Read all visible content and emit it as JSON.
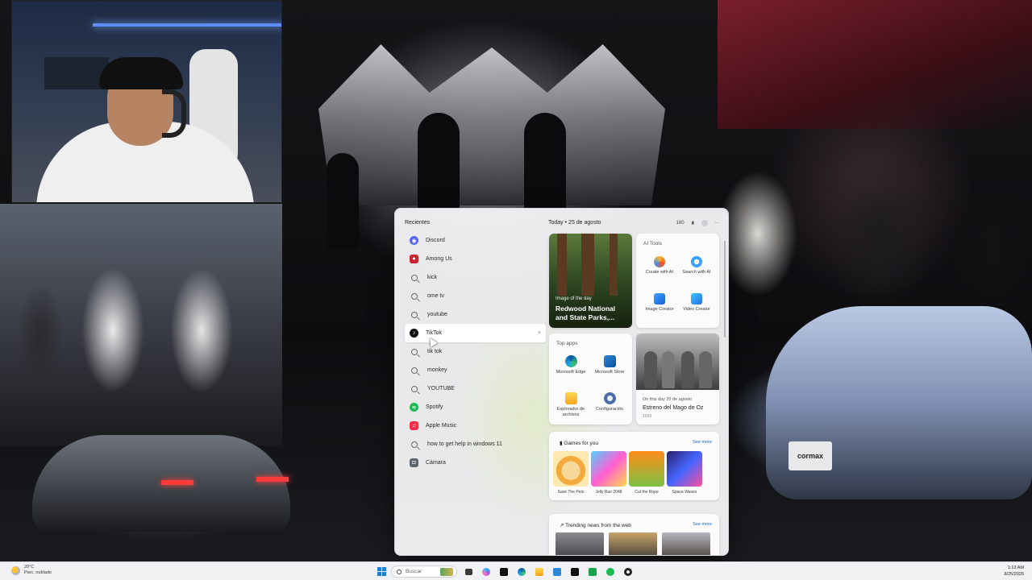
{
  "start_menu": {
    "recent_title": "Recientes",
    "recent": [
      {
        "label": "Discord",
        "icon": "discord-icon",
        "color": "#5865F2",
        "type": "app"
      },
      {
        "label": "Among Us",
        "icon": "among-us-icon",
        "color": "#c7262c",
        "type": "app"
      },
      {
        "label": "kick",
        "icon": "search-icon",
        "type": "search"
      },
      {
        "label": "ome tv",
        "icon": "search-icon",
        "type": "search"
      },
      {
        "label": "youtube",
        "icon": "search-icon",
        "type": "search"
      },
      {
        "label": "TikTok",
        "icon": "tiktok-icon",
        "color": "#111111",
        "type": "app",
        "active": true
      },
      {
        "label": "tik tok",
        "icon": "search-icon",
        "type": "search"
      },
      {
        "label": "monkey",
        "icon": "search-icon",
        "type": "search"
      },
      {
        "label": "YOUTUBE",
        "icon": "search-icon",
        "type": "search"
      },
      {
        "label": "Spotify",
        "icon": "spotify-icon",
        "color": "#1DB954",
        "type": "app"
      },
      {
        "label": "Apple Music",
        "icon": "apple-music-icon",
        "color": "#fa2d48",
        "type": "app"
      },
      {
        "label": "how to get help in windows 11",
        "icon": "search-icon",
        "type": "search"
      },
      {
        "label": "Cámara",
        "icon": "camera-icon",
        "color": "#5b6270",
        "type": "app"
      }
    ],
    "close_glyph": "×"
  },
  "widgets": {
    "today": "Today",
    "sep": "•",
    "date": "25 de agosto",
    "points": "160",
    "more": "···",
    "image_of_day": {
      "label": "Image of the day",
      "title": "Redwood National and State Parks,..."
    },
    "ai_tools": {
      "title": "AI Tools",
      "items": [
        "Create with AI",
        "Search with AI",
        "Image Creator",
        "Video Creator"
      ]
    },
    "top_apps": {
      "title": "Top apps",
      "items": [
        "Microsoft Edge",
        "Microsoft Store",
        "Explorador de archivos",
        "Configuración"
      ]
    },
    "on_this_day": {
      "date": "On this day 25 de agosto",
      "title": "Estreno del Mago de Oz",
      "year": "1939"
    },
    "games": {
      "title": "Games for you",
      "see_more": "See more",
      "items": [
        "Save The Pets",
        "Jelly Run 2048",
        "Cut the Rope",
        "Space Waves"
      ]
    },
    "news": {
      "title": "Trending news from the web",
      "see_more": "See more"
    }
  },
  "taskbar": {
    "weather_temp": "20°C",
    "weather_desc": "Parc. nublado",
    "search_placeholder": "Buscar",
    "time": "1:13 AM",
    "date": "8/25/2026"
  },
  "wallpaper": {
    "plate_text": "cormax"
  },
  "colors": {
    "accent": "#1a64b8",
    "menu_bg": "#f3f3f5"
  }
}
